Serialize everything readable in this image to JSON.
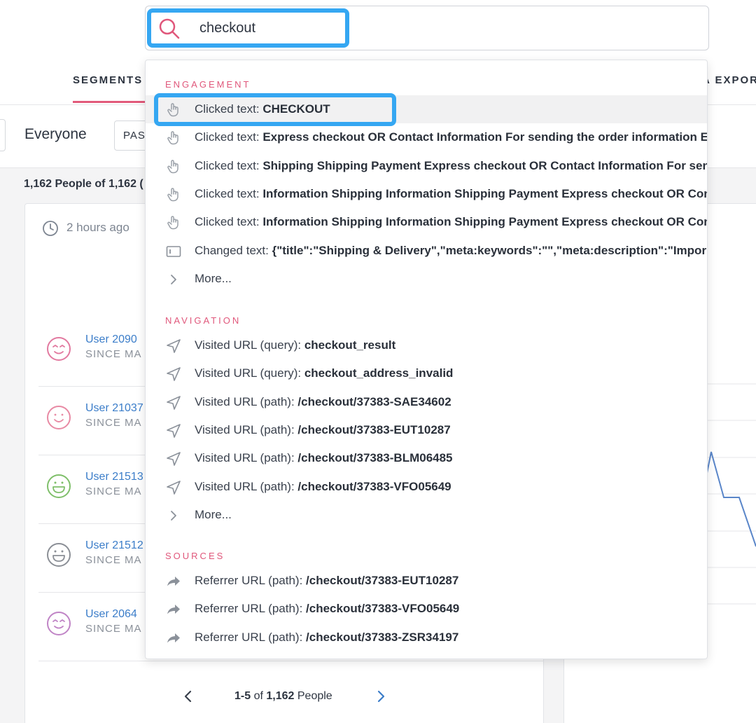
{
  "search": {
    "value": "checkout"
  },
  "nav": {
    "left_tab": "SEGMENTS",
    "right_tab": "A EXPOR"
  },
  "segment": {
    "name": "Everyone",
    "period_label": "PAS"
  },
  "people": {
    "count_text": "1,162 People of 1,162 (",
    "time_ago": "2 hours ago",
    "users": [
      {
        "name": "User 2090",
        "since": "SINCE MA",
        "avatar": "wink-face-icon",
        "color": "#e27aa0"
      },
      {
        "name": "User 21037",
        "since": "SINCE MA",
        "avatar": "smile-face-icon",
        "color": "#e88aa4"
      },
      {
        "name": "User 21513",
        "since": "SINCE MA",
        "avatar": "grin-face-icon",
        "color": "#7fbf6a"
      },
      {
        "name": "User 21512",
        "since": "SINCE MA",
        "avatar": "grin-face-icon",
        "color": "#8b8f96"
      },
      {
        "name": "User 2064",
        "since": "SINCE MA",
        "avatar": "wink-face-icon",
        "color": "#c084c6"
      }
    ],
    "pager": {
      "range": "1-5",
      "of": "of",
      "total": "1,162",
      "unit": "People"
    }
  },
  "dropdown": {
    "sections": [
      {
        "title": "ENGAGEMENT",
        "items": [
          {
            "icon": "pointer-hand-icon",
            "prefix": "Clicked text: ",
            "value": "CHECKOUT",
            "hover": true
          },
          {
            "icon": "pointer-hand-icon",
            "prefix": "Clicked text: ",
            "value": "Express checkout OR Contact Information For sending the order information En"
          },
          {
            "icon": "pointer-hand-icon",
            "prefix": "Clicked text: ",
            "value": "Shipping Shipping Payment Express checkout OR Contact Information For sendi"
          },
          {
            "icon": "pointer-hand-icon",
            "prefix": "Clicked text: ",
            "value": "Information Shipping Information Shipping Payment Express checkout OR Cont"
          },
          {
            "icon": "pointer-hand-icon",
            "prefix": "Clicked text: ",
            "value": "Information Shipping Information Shipping Payment Express checkout OR Cont"
          },
          {
            "icon": "text-field-icon",
            "prefix": "Changed text: ",
            "value": "{\"title\":\"Shipping & Delivery\",\"meta:keywords\":\"\",\"meta:description\":\"Impor"
          },
          {
            "icon": "chevron-right-icon",
            "prefix": "More...",
            "value": ""
          }
        ]
      },
      {
        "title": "NAVIGATION",
        "items": [
          {
            "icon": "navigation-arrow-icon",
            "prefix": "Visited URL (query): ",
            "value": "checkout_result"
          },
          {
            "icon": "navigation-arrow-icon",
            "prefix": "Visited URL (query): ",
            "value": "checkout_address_invalid"
          },
          {
            "icon": "navigation-arrow-icon",
            "prefix": "Visited URL (path): ",
            "value": "/checkout/37383-SAE34602"
          },
          {
            "icon": "navigation-arrow-icon",
            "prefix": "Visited URL (path): ",
            "value": "/checkout/37383-EUT10287"
          },
          {
            "icon": "navigation-arrow-icon",
            "prefix": "Visited URL (path): ",
            "value": "/checkout/37383-BLM06485"
          },
          {
            "icon": "navigation-arrow-icon",
            "prefix": "Visited URL (path): ",
            "value": "/checkout/37383-VFO05649"
          },
          {
            "icon": "chevron-right-icon",
            "prefix": "More...",
            "value": ""
          }
        ]
      },
      {
        "title": "SOURCES",
        "items": [
          {
            "icon": "share-arrow-icon",
            "prefix": "Referrer URL (path): ",
            "value": "/checkout/37383-EUT10287"
          },
          {
            "icon": "share-arrow-icon",
            "prefix": "Referrer URL (path): ",
            "value": "/checkout/37383-VFO05649"
          },
          {
            "icon": "share-arrow-icon",
            "prefix": "Referrer URL (path): ",
            "value": "/checkout/37383-ZSR34197"
          }
        ]
      }
    ]
  },
  "colors": {
    "accent": "#e0577b",
    "highlight": "#35a7f2",
    "link": "#3b7dc9",
    "chart_line": "#5a86c9"
  }
}
